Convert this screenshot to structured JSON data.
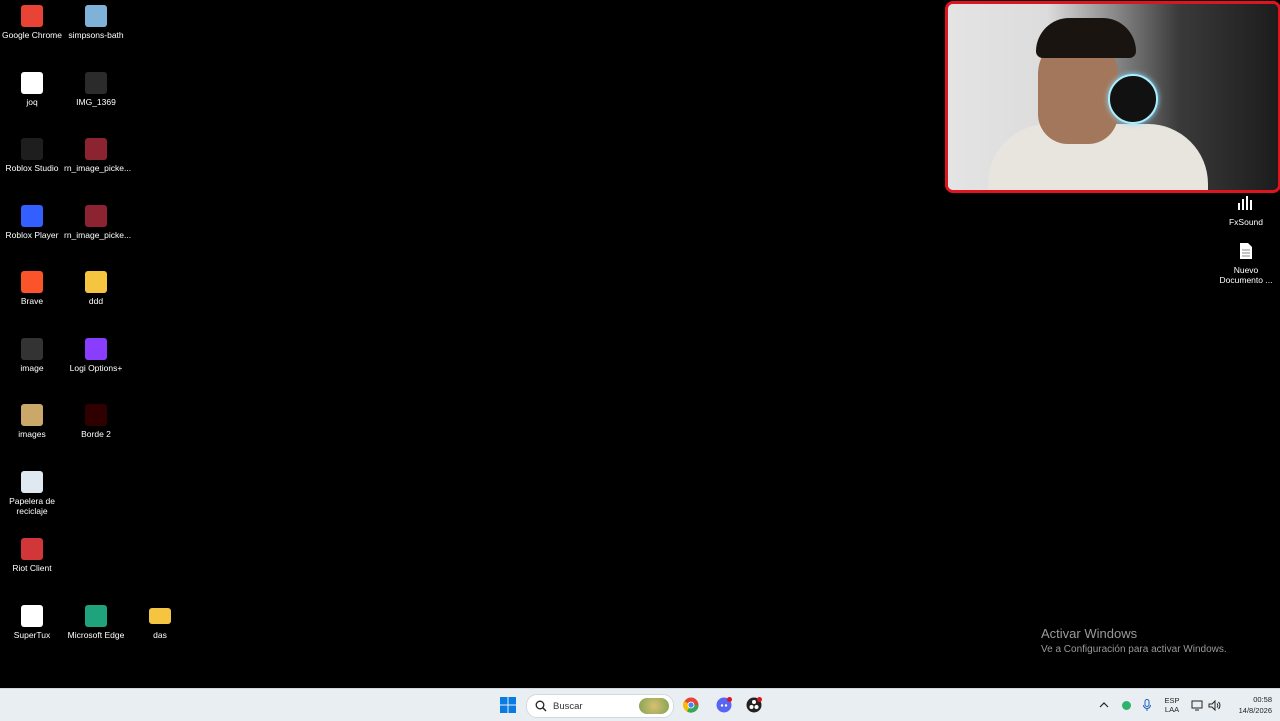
{
  "desktop": {
    "icons_col1": [
      {
        "label": "Google Chrome",
        "icon": "chrome-icon",
        "color": "#e84335"
      },
      {
        "label": "joq",
        "icon": "document-icon",
        "color": "#ffffff"
      },
      {
        "label": "Roblox Studio",
        "icon": "roblox-studio-icon",
        "color": "#1e1e1e"
      },
      {
        "label": "Roblox Player",
        "icon": "roblox-player-icon",
        "color": "#335fff"
      },
      {
        "label": "Brave",
        "icon": "brave-icon",
        "color": "#fb542b"
      },
      {
        "label": "image",
        "icon": "image-file-icon",
        "color": "#333333"
      },
      {
        "label": "images",
        "icon": "images-file-icon",
        "color": "#c9a86a"
      },
      {
        "label": "Papelera de reciclaje",
        "icon": "recycle-bin-icon",
        "color": "#dfe9f1"
      },
      {
        "label": "Riot Client",
        "icon": "riot-client-icon",
        "color": "#d13639"
      },
      {
        "label": "SuperTux",
        "icon": "supertux-icon",
        "color": "#ffffff"
      }
    ],
    "icons_col2": [
      {
        "label": "simpsons-bath",
        "icon": "image-file-icon",
        "color": "#7fb2d9"
      },
      {
        "label": "IMG_1369",
        "icon": "image-file-icon",
        "color": "#2b2b2b"
      },
      {
        "label": "rn_image_picke...",
        "icon": "image-file-icon",
        "color": "#8b2331"
      },
      {
        "label": "rn_image_picke...",
        "icon": "image-file-icon",
        "color": "#8b2331"
      },
      {
        "label": "ddd",
        "icon": "folder-icon",
        "color": "#f5c542"
      },
      {
        "label": "Logi Options+",
        "icon": "logi-options-icon",
        "color": "#8b3dff"
      },
      {
        "label": "Borde 2",
        "icon": "image-file-icon",
        "color": "#300000"
      },
      {
        "label": "Microsoft Edge",
        "icon": "edge-icon",
        "color": "#1fa37c"
      }
    ],
    "icon_col3": {
      "label": "das",
      "icon": "folder-icon",
      "color": "#f5c542"
    },
    "right_icons": [
      {
        "label": "FxSound",
        "icon": "fxsound-icon"
      },
      {
        "label": "Nuevo Documento ...",
        "icon": "text-document-icon"
      }
    ]
  },
  "webcam": {
    "border_color": "#e0141e"
  },
  "activation": {
    "title": "Activar Windows",
    "subtitle": "Ve a Configuración para activar Windows."
  },
  "taskbar": {
    "search_placeholder": "Buscar",
    "tray": {
      "lang_line1": "ESP",
      "lang_line2": "LAA",
      "time": "00:58",
      "date": "14/8/2026"
    }
  }
}
